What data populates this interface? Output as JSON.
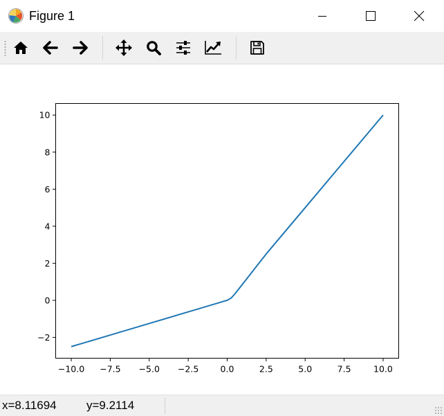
{
  "window": {
    "title": "Figure 1",
    "icon": "matplotlib-logo-icon",
    "controls": [
      "minimize-icon",
      "maximize-icon",
      "close-icon"
    ]
  },
  "toolbar": {
    "buttons": [
      {
        "name": "home",
        "icon": "home-icon"
      },
      {
        "name": "back",
        "icon": "arrow-left-icon"
      },
      {
        "name": "forward",
        "icon": "arrow-right-icon"
      },
      {
        "name": "pan",
        "icon": "move-icon"
      },
      {
        "name": "zoom",
        "icon": "magnifier-icon"
      },
      {
        "name": "subplots",
        "icon": "sliders-icon"
      },
      {
        "name": "customize",
        "icon": "line-chart-icon"
      },
      {
        "name": "save",
        "icon": "floppy-disk-icon"
      }
    ]
  },
  "status": {
    "x_readout": "x=8.11694",
    "y_readout": "y=9.2114"
  },
  "colors": {
    "line": "#1f77b4",
    "toolbar_bg": "#f0f0f0"
  },
  "chart_data": {
    "type": "line",
    "title": "",
    "xlabel": "",
    "ylabel": "",
    "xlim": [
      -11.0,
      11.0
    ],
    "ylim": [
      -3.125,
      10.625
    ],
    "xticks": [
      -10.0,
      -7.5,
      -5.0,
      -2.5,
      0.0,
      2.5,
      5.0,
      7.5,
      10.0
    ],
    "xtick_labels": [
      "−10.0",
      "−7.5",
      "−5.0",
      "−2.5",
      "0.0",
      "2.5",
      "5.0",
      "7.5",
      "10.0"
    ],
    "yticks": [
      -2,
      0,
      2,
      4,
      6,
      8,
      10
    ],
    "ytick_labels": [
      "−2",
      "0",
      "2",
      "4",
      "6",
      "8",
      "10"
    ],
    "grid": false,
    "series": [
      {
        "color": "#1f77b4",
        "x": [
          -10,
          -7.5,
          -5,
          -2.5,
          -0.5,
          -0.25,
          0,
          0.25,
          0.5,
          2.5,
          5,
          7.5,
          10
        ],
        "y": [
          -2.5,
          -1.875,
          -1.25,
          -0.625,
          -0.125,
          -0.06,
          0.0,
          0.12,
          0.35,
          2.5,
          5,
          7.5,
          10
        ]
      }
    ]
  }
}
